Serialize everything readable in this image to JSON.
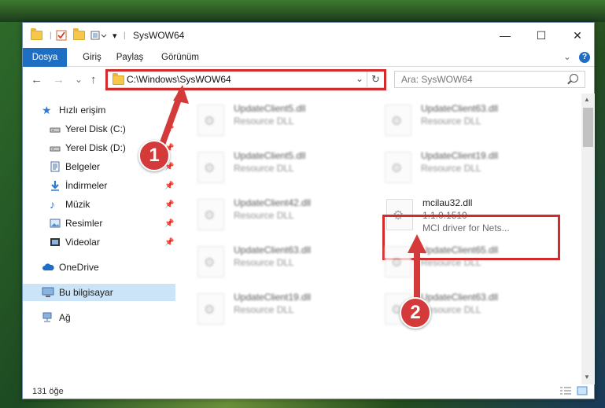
{
  "window": {
    "title": "SysWOW64",
    "minimize_icon": "—",
    "maximize_icon": "☐",
    "close_icon": "✕"
  },
  "ribbon": {
    "tabs": [
      "Dosya",
      "Giriş",
      "Paylaş",
      "Görünüm"
    ],
    "collapse_icon": "⌄",
    "help_icon": "?"
  },
  "nav": {
    "back": "←",
    "forward": "→",
    "recent": "⌄",
    "up": "↑",
    "address": "C:\\Windows\\SysWOW64",
    "address_dropdown": "⌄",
    "refresh": "↻",
    "search_placeholder": "Ara: SysWOW64"
  },
  "sidebar": {
    "items": [
      {
        "label": "Hızlı erişim",
        "icon": "star-icon"
      },
      {
        "label": "Yerel Disk (C:)",
        "icon": "drive-icon"
      },
      {
        "label": "Yerel Disk (D:)",
        "icon": "drive-icon"
      },
      {
        "label": "Belgeler",
        "icon": "documents-icon"
      },
      {
        "label": "İndirmeler",
        "icon": "download-icon"
      },
      {
        "label": "Müzik",
        "icon": "music-icon"
      },
      {
        "label": "Resimler",
        "icon": "pictures-icon"
      },
      {
        "label": "Videolar",
        "icon": "videos-icon"
      },
      {
        "label": "OneDrive",
        "icon": "cloud-icon"
      },
      {
        "label": "Bu bilgisayar",
        "icon": "computer-icon"
      },
      {
        "label": "Ağ",
        "icon": "network-icon"
      }
    ]
  },
  "files": [
    {
      "name": "UpdateClient5.dll",
      "desc": "Resource DLL"
    },
    {
      "name": "UpdateClient63.dll",
      "desc": "Resource DLL"
    },
    {
      "name": "UpdateClient5.dll",
      "desc": "Resource DLL"
    },
    {
      "name": "UpdateClient19.dll",
      "desc": "Resource DLL"
    },
    {
      "name": "UpdateClient42.dll",
      "desc": "Resource DLL"
    },
    {
      "name": "mcilau32.dll",
      "version": "1.1.0.1510",
      "desc": "MCI driver for Nets..."
    },
    {
      "name": "UpdateClient63.dll",
      "desc": "Resource DLL"
    },
    {
      "name": "UpdateClient65.dll",
      "desc": "Resource DLL"
    },
    {
      "name": "UpdateClient19.dll",
      "desc": "Resource DLL"
    },
    {
      "name": "UpdateClient63.dll",
      "desc": "Resource DLL"
    }
  ],
  "status": {
    "count": "131 öğe"
  },
  "callouts": [
    "1",
    "2"
  ],
  "colors": {
    "accent": "#1e6fc4",
    "highlight": "#d42a2a",
    "selection": "#cce4f7"
  }
}
